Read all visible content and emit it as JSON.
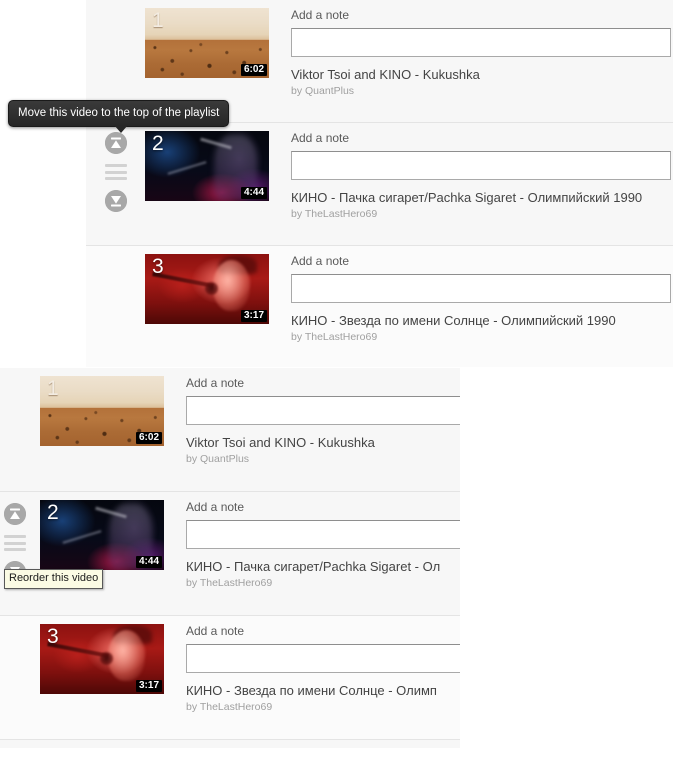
{
  "panels": {
    "top": {
      "name": "playlist-editor-top",
      "rows": [
        {
          "index": "1",
          "duration": "6:02",
          "note_label": "Add a note",
          "note_value": "",
          "note_placeholder": "",
          "title": "Viktor Tsoi and KINO - Kukushka",
          "byline": "by QuantPlus",
          "thumb": "desert-landscape-thumbnail"
        },
        {
          "index": "2",
          "duration": "4:44",
          "note_label": "Add a note",
          "note_value": "",
          "note_placeholder": "",
          "title": "КИНО - Пачка сигарет/Pachka Sigaret - Олимпийский 1990",
          "byline": "by TheLastHero69",
          "thumb": "concert-stage-thumbnail"
        },
        {
          "index": "3",
          "duration": "3:17",
          "note_label": "Add a note",
          "note_value": "",
          "note_placeholder": "",
          "title": "КИНО - Звезда по имени Солнце - Олимпийский 1990",
          "byline": "by TheLastHero69",
          "thumb": "red-singer-thumbnail"
        }
      ]
    },
    "bottom": {
      "name": "playlist-editor-bottom",
      "rows": [
        {
          "index": "1",
          "duration": "6:02",
          "note_label": "Add a note",
          "note_value": "",
          "note_placeholder": "",
          "title": "Viktor Tsoi and KINO - Kukushka",
          "byline": "by QuantPlus",
          "thumb": "desert-landscape-thumbnail"
        },
        {
          "index": "2",
          "duration": "4:44",
          "note_label": "Add a note",
          "note_value": "",
          "note_placeholder": "",
          "title": "КИНО - Пачка сигарет/Pachka Sigaret - Ол",
          "byline": "by TheLastHero69",
          "thumb": "concert-stage-thumbnail"
        },
        {
          "index": "3",
          "duration": "3:17",
          "note_label": "Add a note",
          "note_value": "",
          "note_placeholder": "",
          "title": "КИНО - Звезда по имени Солнце - Олимп",
          "byline": "by TheLastHero69",
          "thumb": "red-singer-thumbnail"
        }
      ]
    }
  },
  "tooltips": {
    "move_to_top": "Move this video to the top of the playlist",
    "reorder": "Reorder this video"
  },
  "controls": {
    "move_top_icon": "move-to-top-icon",
    "reorder_handle_icon": "reorder-handle-icon",
    "move_bottom_icon": "move-to-bottom-icon"
  },
  "colors": {
    "panel_background": "#f7f7f7",
    "row_divider": "#e4e4e4",
    "title_text": "#444444",
    "byline_text": "#a0a0a0",
    "control_circle": "#a8a8a8",
    "tooltip_dark_bg": "#2b2b2b",
    "tooltip_native_bg": "#fbfbe4",
    "duration_badge_bg": "#000000"
  }
}
